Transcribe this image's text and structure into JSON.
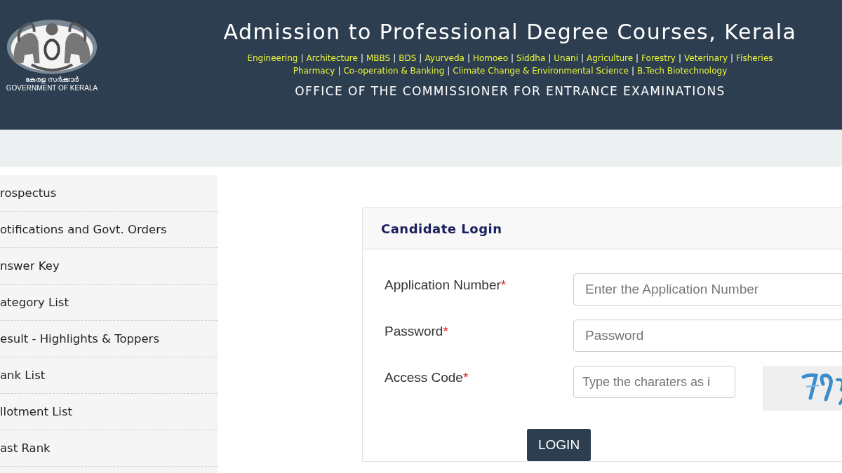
{
  "header": {
    "emblem_caption_local": "കേരള സർക്കാർ",
    "emblem_caption": "GOVERNMENT OF KERALA",
    "title": "Admission to Professional Degree Courses, Kerala",
    "separator": "|",
    "course_lines": [
      [
        "Engineering",
        "Architecture",
        "MBBS",
        "BDS",
        "Ayurveda",
        "Homoeo",
        "Siddha",
        "Unani",
        "Agriculture",
        "Forestry",
        "Veterinary",
        "Fisheries"
      ],
      [
        "Pharmacy",
        "Co-operation & Banking",
        "Climate Change & Environmental Science",
        "B.Tech Biotechnology"
      ]
    ],
    "subtitle": "OFFICE OF THE COMMISSIONER FOR ENTRANCE EXAMINATIONS"
  },
  "sidebar": {
    "items": [
      {
        "label": "rospectus"
      },
      {
        "label": "otifications and Govt. Orders"
      },
      {
        "label": "nswer Key"
      },
      {
        "label": "ategory List"
      },
      {
        "label": "esult - Highlights & Toppers"
      },
      {
        "label": "ank List"
      },
      {
        "label": "llotment List"
      },
      {
        "label": "ast Rank"
      }
    ]
  },
  "login": {
    "title": "Candidate Login",
    "required_mark": "*",
    "fields": [
      {
        "kind": "text",
        "label": "Application Number",
        "required": true,
        "placeholder": "Enter the Application Number"
      },
      {
        "kind": "password",
        "label": "Password",
        "required": true,
        "placeholder": "Password"
      },
      {
        "kind": "captcha",
        "label": "Access Code",
        "required": true,
        "placeholder": "Type the charaters as i"
      }
    ],
    "button": "LOGIN"
  }
}
